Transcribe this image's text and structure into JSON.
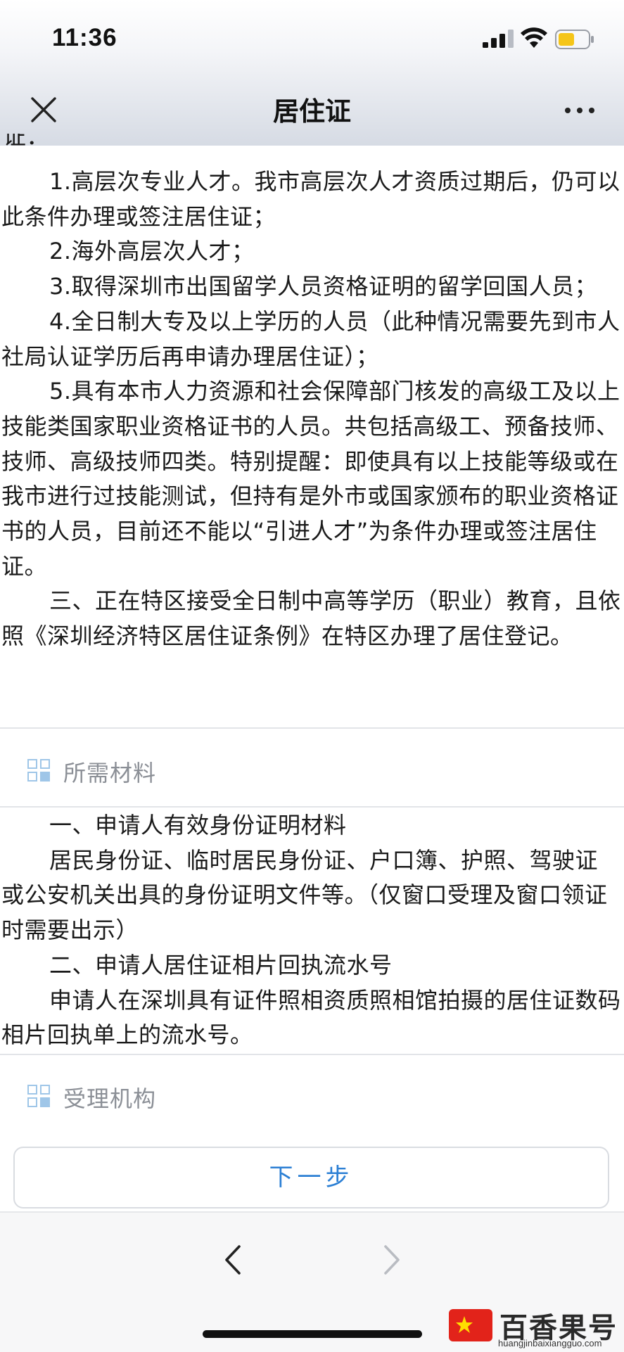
{
  "status_bar": {
    "time": "11:36",
    "icons": [
      "signal-icon",
      "wifi-icon",
      "battery-icon"
    ],
    "battery_color": "#f5c518"
  },
  "nav": {
    "title": "居住证",
    "close_icon": "close-icon",
    "more_icon": "more-icon"
  },
  "content": {
    "clipped_line": "证：",
    "conditions": [
      "1.高层次专业人才。我市高层次人才资质过期后，仍可以此条件办理或签注居住证；",
      "2.海外高层次人才；",
      "3.取得深圳市出国留学人员资格证明的留学回国人员；",
      "4.全日制大专及以上学历的人员（此种情况需要先到市人社局认证学历后再申请办理居住证）；",
      "5.具有本市人力资源和社会保障部门核发的高级工及以上技能类国家职业资格证书的人员。共包括高级工、预备技师、技师、高级技师四类。特别提醒：即使具有以上技能等级或在我市进行过技能测试，但持有是外市或国家颁布的职业资格证书的人员，目前还不能以“引进人才”为条件办理或签注居住证。",
      "三、正在特区接受全日制中高等学历（职业）教育，且依照《深圳经济特区居住证条例》在特区办理了居住登记。"
    ]
  },
  "materials": {
    "label": "所需材料",
    "items": [
      "一、申请人有效身份证明材料",
      "居民身份证、临时居民身份证、户口簿、护照、驾驶证 或公安机关出具的身份证明文件等。（仅窗口受理及窗口领证时需要出示）",
      "二、申请人居住证相片回执流水号",
      "申请人在深圳具有证件照相资质照相馆拍摄的居住证数码相片回执单上的流水号。"
    ]
  },
  "agency": {
    "label": "受理机构"
  },
  "next_button": {
    "label": "下一步",
    "color": "#2b7fd4"
  },
  "browser_bar": {
    "back_icon": "chevron-left-icon",
    "forward_icon": "chevron-right-icon"
  },
  "watermark": {
    "text": "百香果号",
    "url": "huangjinbaixiangguo.com"
  }
}
